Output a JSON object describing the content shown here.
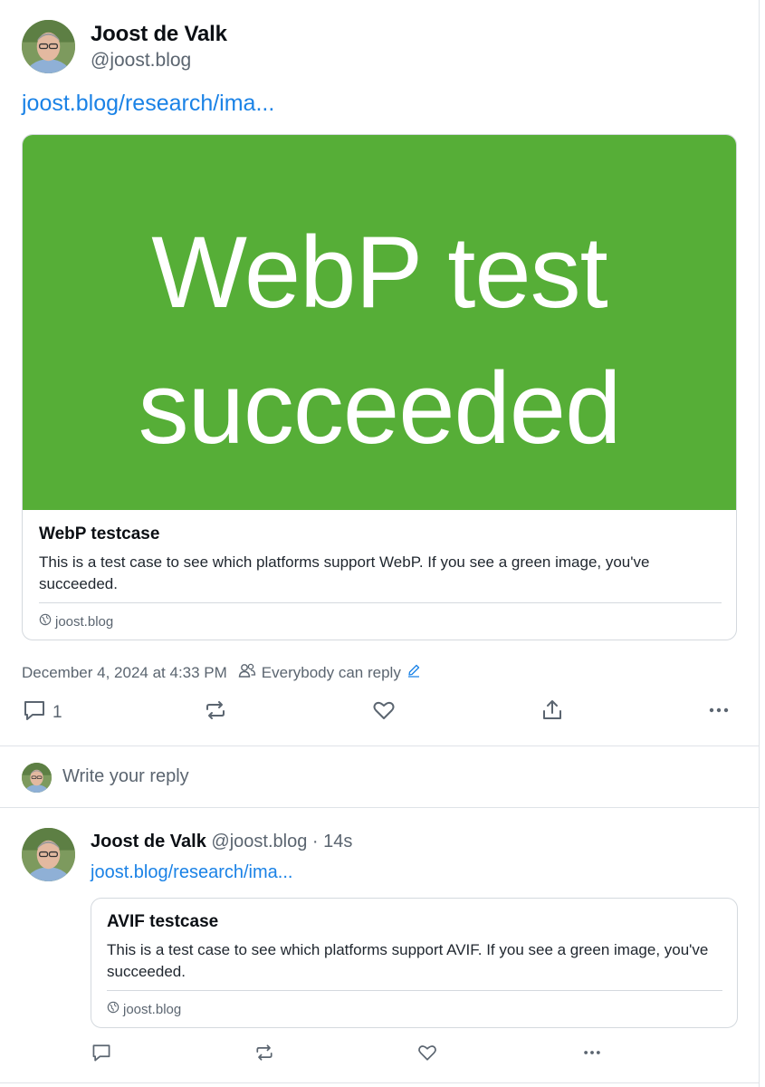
{
  "post": {
    "author_name": "Joost de Valk",
    "author_handle": "@joost.blog",
    "link_text": "joost.blog/research/ima...",
    "card": {
      "image_text_line1": "WebP test",
      "image_text_line2": "succeeded",
      "image_color": "#56ae37",
      "title": "WebP testcase",
      "description": "This is a test case to see which platforms support WebP. If you see a green image, you've succeeded.",
      "domain": "joost.blog"
    },
    "timestamp": "December 4, 2024 at 4:33 PM",
    "reply_setting": "Everybody can reply",
    "reply_count": "1"
  },
  "composer": {
    "placeholder": "Write your reply"
  },
  "reply": {
    "author_name": "Joost de Valk",
    "author_handle": "@joost.blog",
    "time_ago": "· 14s",
    "link_text": "joost.blog/research/ima...",
    "card": {
      "title": "AVIF testcase",
      "description": "This is a test case to see which platforms support AVIF. If you see a green image, you've succeeded.",
      "domain": "joost.blog"
    }
  },
  "colors": {
    "link": "#1a82e6",
    "muted": "#5b6570",
    "border": "#d4d9de"
  },
  "icons": [
    "avatar",
    "comment-icon",
    "repost-icon",
    "like-icon",
    "share-icon",
    "more-icon",
    "globe-icon",
    "people-icon",
    "edit-icon"
  ]
}
